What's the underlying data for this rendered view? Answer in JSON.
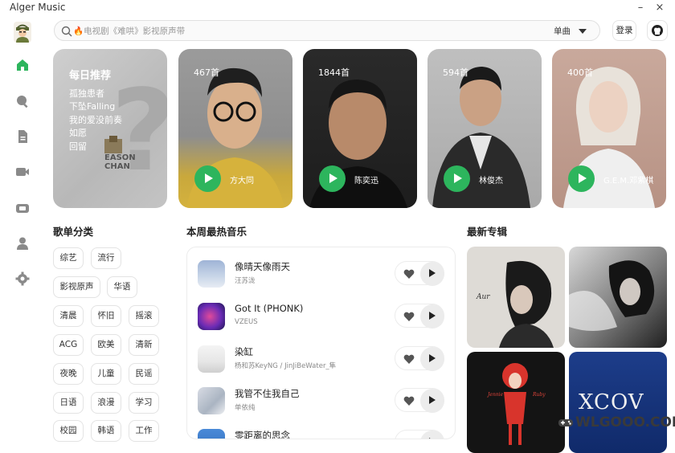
{
  "app": {
    "title": "Alger Music"
  },
  "window": {
    "minimize": "–",
    "close": "×"
  },
  "search": {
    "placeholder": "🔥电视剧《难哄》影视原声带",
    "type": "单曲"
  },
  "header": {
    "login": "登录"
  },
  "sidebar": {
    "items": [
      "home-icon",
      "search-icon",
      "document-icon",
      "video-icon",
      "radio-icon",
      "user-icon",
      "settings-icon"
    ]
  },
  "daily": {
    "title": "每日推荐",
    "songs": [
      "孤独患者",
      "下坠Falling",
      "我的爱没前奏",
      "如愿",
      "回留"
    ],
    "cover_text": [
      "EASON",
      "CHAN"
    ]
  },
  "artists": [
    {
      "count": "467首",
      "name": "方大同"
    },
    {
      "count": "1844首",
      "name": "陈奕迅"
    },
    {
      "count": "594首",
      "name": "林俊杰"
    },
    {
      "count": "400首",
      "name": "G.E.M.邓紫棋"
    }
  ],
  "sections": {
    "categories": "歌单分类",
    "hot": "本周最热音乐",
    "albums": "最新专辑"
  },
  "categories": [
    "综艺",
    "流行",
    "影视原声",
    "华语",
    "清晨",
    "怀旧",
    "摇滚",
    "ACG",
    "欧美",
    "清新",
    "夜晚",
    "儿童",
    "民谣",
    "日语",
    "浪漫",
    "学习",
    "校园",
    "韩语",
    "工作"
  ],
  "hot_songs": [
    {
      "name": "像晴天像雨天",
      "artist": "汪苏泷"
    },
    {
      "name": "Got It (PHONK)",
      "artist": "VZEUS"
    },
    {
      "name": "染缸",
      "artist": "杨和苏KeyNG / JinJiBeWater_隼"
    },
    {
      "name": "我管不住我自己",
      "artist": "单依纯"
    },
    {
      "name": "零距离的思念",
      "artist": ""
    }
  ],
  "albums": {
    "album1_text": "Aur",
    "album3_text": [
      "Jennie",
      "Ruby"
    ],
    "album4_text": "XCOV"
  },
  "watermark": "WLGOOO.COM",
  "colors": {
    "accent": "#2db55d",
    "background": "#ffffff"
  }
}
